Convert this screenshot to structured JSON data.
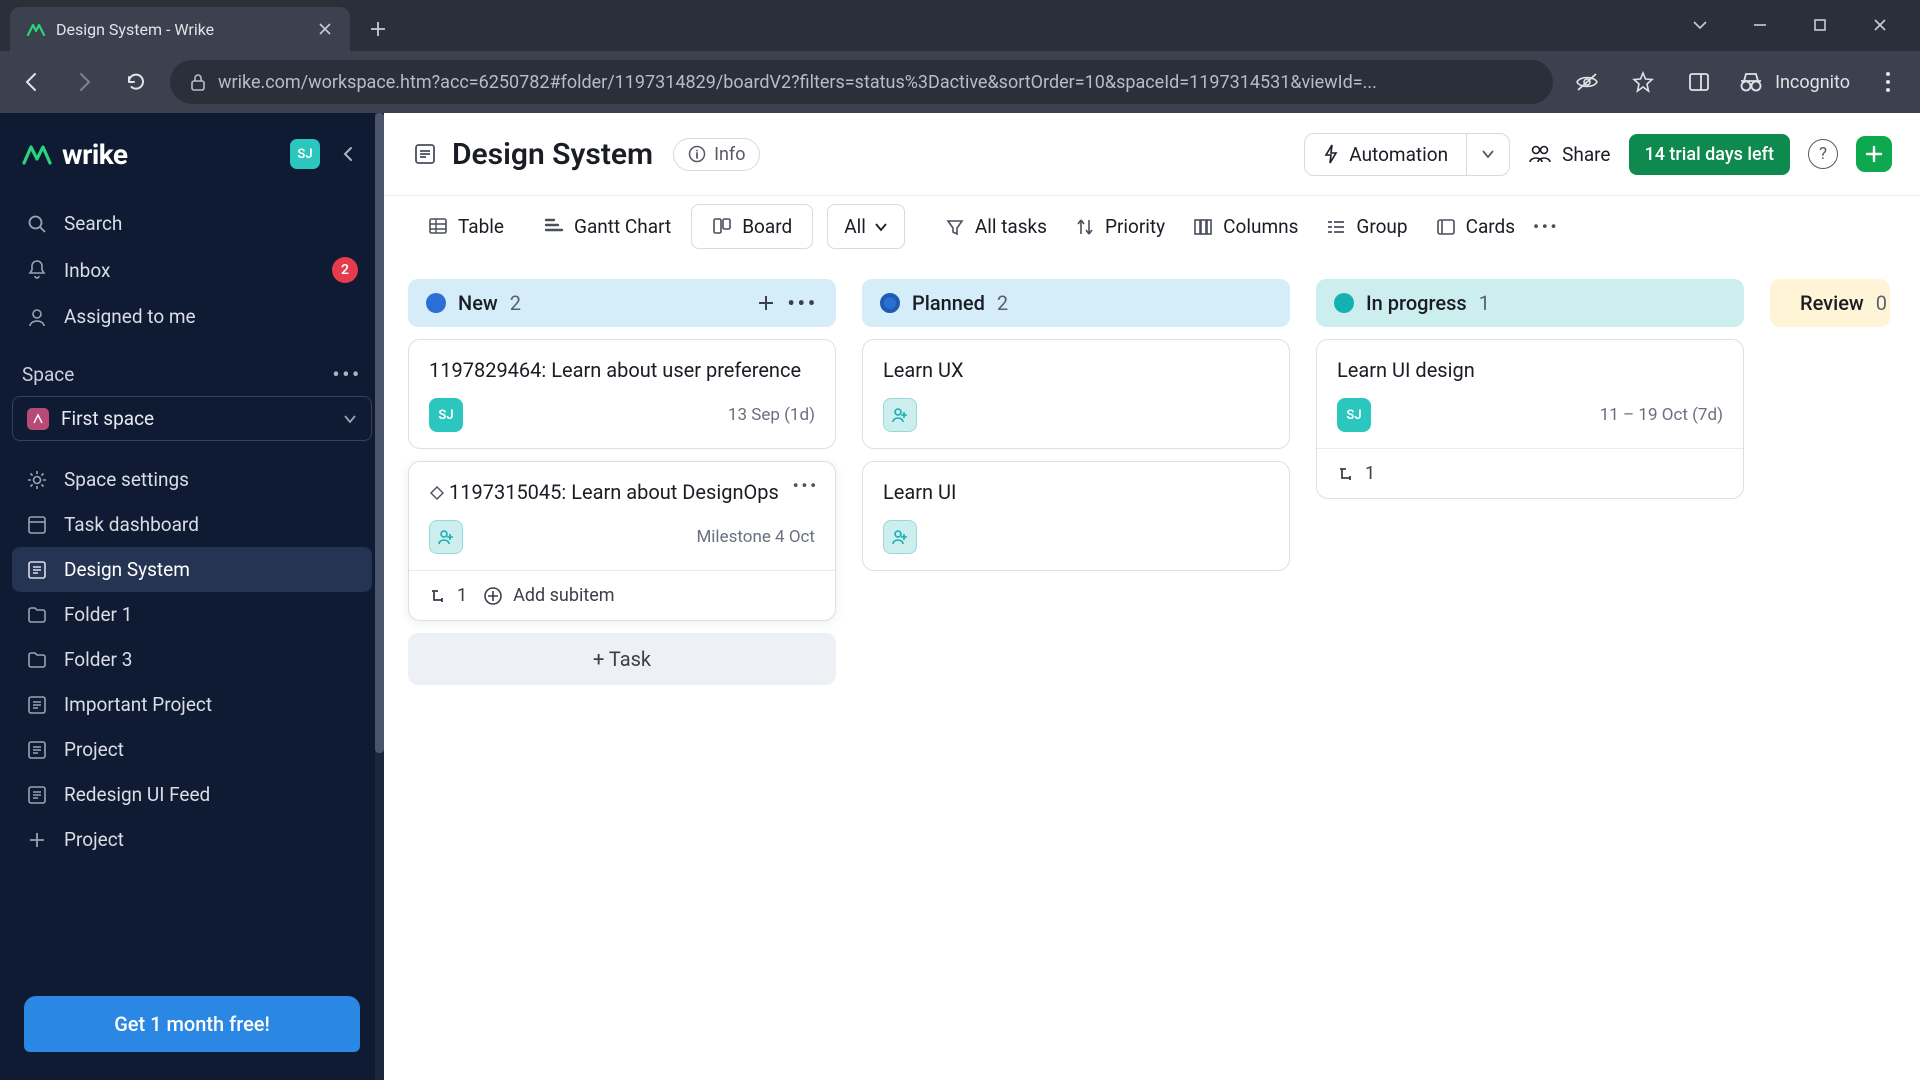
{
  "browser": {
    "tab_title": "Design System - Wrike",
    "url": "wrike.com/workspace.htm?acc=6250782#folder/1197314829/boardV2?filters=status%3Dactive&sortOrder=10&spaceId=1197314531&viewId=...",
    "incognito_label": "Incognito"
  },
  "sidebar": {
    "brand": "wrike",
    "avatar": "SJ",
    "search": "Search",
    "inbox": "Inbox",
    "inbox_badge": "2",
    "assigned": "Assigned to me",
    "space_label": "Space",
    "first_space": "First space",
    "items": [
      "Space settings",
      "Task dashboard",
      "Design System",
      "Folder 1",
      "Folder 3",
      "Important Project",
      "Project",
      "Redesign UI Feed"
    ],
    "add_project": "Project",
    "promo": "Get 1 month free!"
  },
  "header": {
    "title": "Design System",
    "info": "Info",
    "automation": "Automation",
    "share": "Share",
    "trial": "14 trial days left"
  },
  "toolbar": {
    "views": {
      "table": "Table",
      "gantt": "Gantt Chart",
      "board": "Board"
    },
    "filter_all": "All",
    "all_tasks": "All tasks",
    "priority": "Priority",
    "columns": "Columns",
    "group": "Group",
    "cards": "Cards"
  },
  "board": {
    "columns": {
      "new": {
        "name": "New",
        "count": "2"
      },
      "planned": {
        "name": "Planned",
        "count": "2"
      },
      "progress": {
        "name": "In progress",
        "count": "1"
      },
      "review": {
        "name": "Review",
        "count": "0"
      }
    },
    "new_cards": [
      {
        "title": "1197829464: Learn about user preference",
        "assignee": "SJ",
        "date": "13 Sep (1d)"
      },
      {
        "title": "1197315045: Learn about DesignOps",
        "date": "Milestone 4 Oct",
        "subitems": "1",
        "add_sub": "Add subitem"
      }
    ],
    "planned_cards": [
      {
        "title": "Learn UX"
      },
      {
        "title": "Learn UI"
      }
    ],
    "progress_cards": [
      {
        "title": "Learn UI design",
        "assignee": "SJ",
        "date": "11 – 19 Oct (7d)",
        "subitems": "1"
      }
    ],
    "add_task": "+ Task"
  }
}
